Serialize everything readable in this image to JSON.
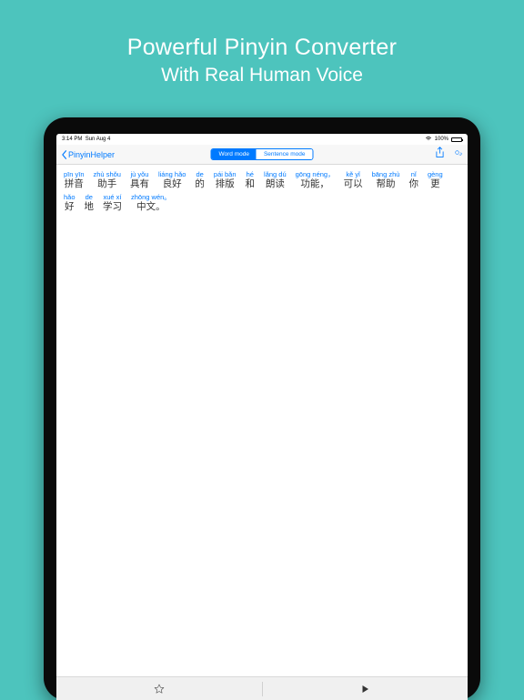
{
  "promo": {
    "title": "Powerful Pinyin Converter",
    "subtitle": "With Real Human Voice"
  },
  "status": {
    "time": "3:14 PM",
    "date": "Sun Aug 4",
    "battery_pct": "100%"
  },
  "nav": {
    "back_label": "PinyinHelper",
    "seg_word": "Word mode",
    "seg_sentence": "Sentence mode"
  },
  "words": [
    {
      "pinyin": "pīn yīn",
      "hanzi": "拼音"
    },
    {
      "pinyin": "zhù shǒu",
      "hanzi": "助手"
    },
    {
      "pinyin": "jù yǒu",
      "hanzi": "具有"
    },
    {
      "pinyin": "liáng hǎo",
      "hanzi": "良好"
    },
    {
      "pinyin": "de",
      "hanzi": "的"
    },
    {
      "pinyin": "pái bǎn",
      "hanzi": "排版"
    },
    {
      "pinyin": "hé",
      "hanzi": "和"
    },
    {
      "pinyin": "lǎng dú",
      "hanzi": "朗读"
    },
    {
      "pinyin": "gōng néng，",
      "hanzi": "功能，"
    },
    {
      "pinyin": "kě yǐ",
      "hanzi": "可以"
    },
    {
      "pinyin": "bāng zhù",
      "hanzi": "帮助"
    },
    {
      "pinyin": "nǐ",
      "hanzi": "你"
    },
    {
      "pinyin": "gèng",
      "hanzi": "更"
    },
    {
      "pinyin": "hǎo",
      "hanzi": "好"
    },
    {
      "pinyin": "de",
      "hanzi": "地"
    },
    {
      "pinyin": "xué xí",
      "hanzi": "学习"
    },
    {
      "pinyin": "zhōng wén。",
      "hanzi": "中文。"
    }
  ]
}
